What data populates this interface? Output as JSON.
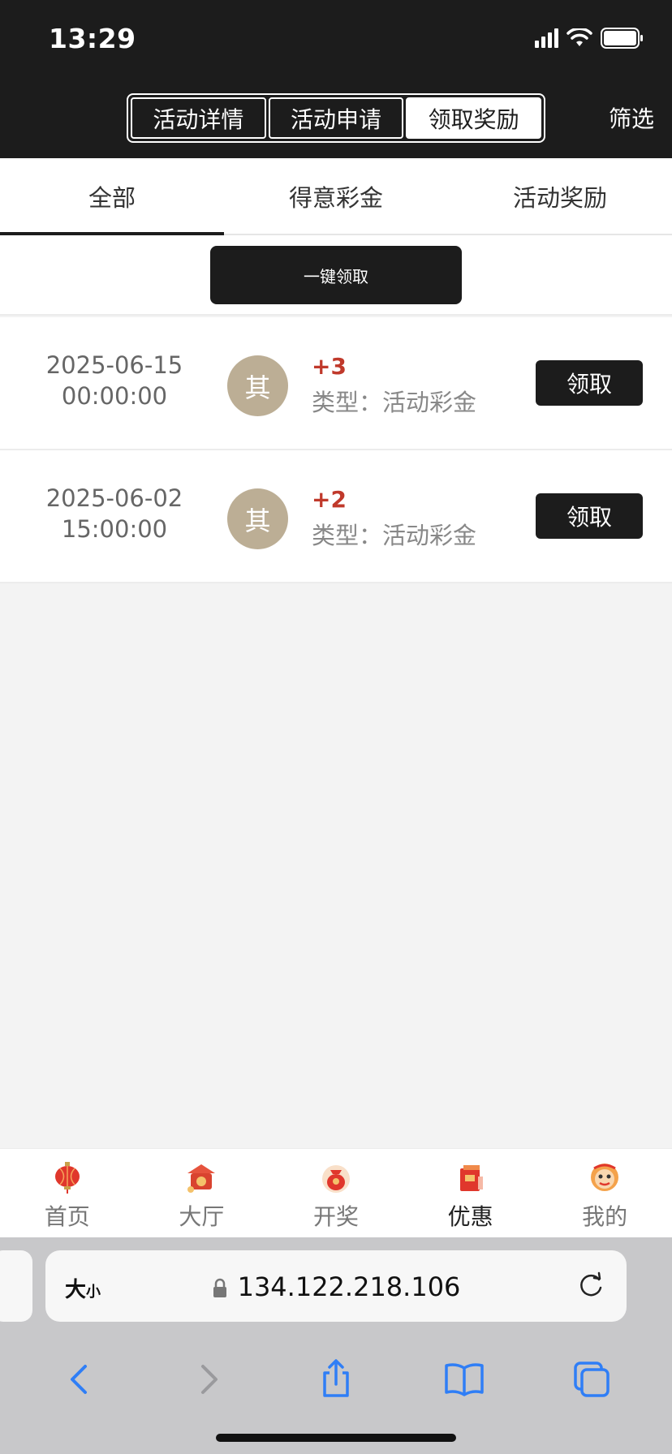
{
  "status_bar": {
    "time": "13:29"
  },
  "header": {
    "segments": [
      "活动详情",
      "活动申请",
      "领取奖励"
    ],
    "active_segment": 2,
    "filter_label": "筛选"
  },
  "tabs": {
    "items": [
      "全部",
      "得意彩金",
      "活动奖励"
    ],
    "active": 0
  },
  "claim_all_label": "一键领取",
  "rewards": [
    {
      "date": "2025-06-15",
      "time": "00:00:00",
      "avatar_char": "其",
      "amount": "+3",
      "type": "类型：活动彩金",
      "button": "领取"
    },
    {
      "date": "2025-06-02",
      "time": "15:00:00",
      "avatar_char": "其",
      "amount": "+2",
      "type": "类型：活动彩金",
      "button": "领取"
    }
  ],
  "bottom_nav": {
    "items": [
      {
        "label": "首页",
        "icon": "lantern-icon"
      },
      {
        "label": "大厅",
        "icon": "lobby-icon"
      },
      {
        "label": "开奖",
        "icon": "lucky-bag-icon"
      },
      {
        "label": "优惠",
        "icon": "gift-icon"
      },
      {
        "label": "我的",
        "icon": "lion-icon"
      }
    ],
    "active": 3
  },
  "browser": {
    "aa_big": "大",
    "aa_small": "小",
    "url": "134.122.218.106"
  },
  "colors": {
    "dark": "#1c1c1c",
    "amount_red": "#c0392b",
    "avatar_bg": "#bcae95"
  }
}
